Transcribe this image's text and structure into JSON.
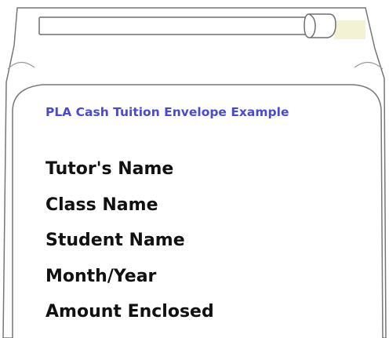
{
  "card": {
    "title": "PLA Cash Tuition Envelope Example",
    "fields": [
      "Tutor's Name",
      "Class Name",
      "Student Name",
      "Month/Year",
      "Amount Enclosed"
    ]
  },
  "colors": {
    "title": "#4a4ad0",
    "text": "#111111",
    "outline": "#777777",
    "tab_accent": "#f4f2d4"
  },
  "icons": {
    "flap": "envelope-flap-icon",
    "tab": "tab-scroll-icon"
  }
}
